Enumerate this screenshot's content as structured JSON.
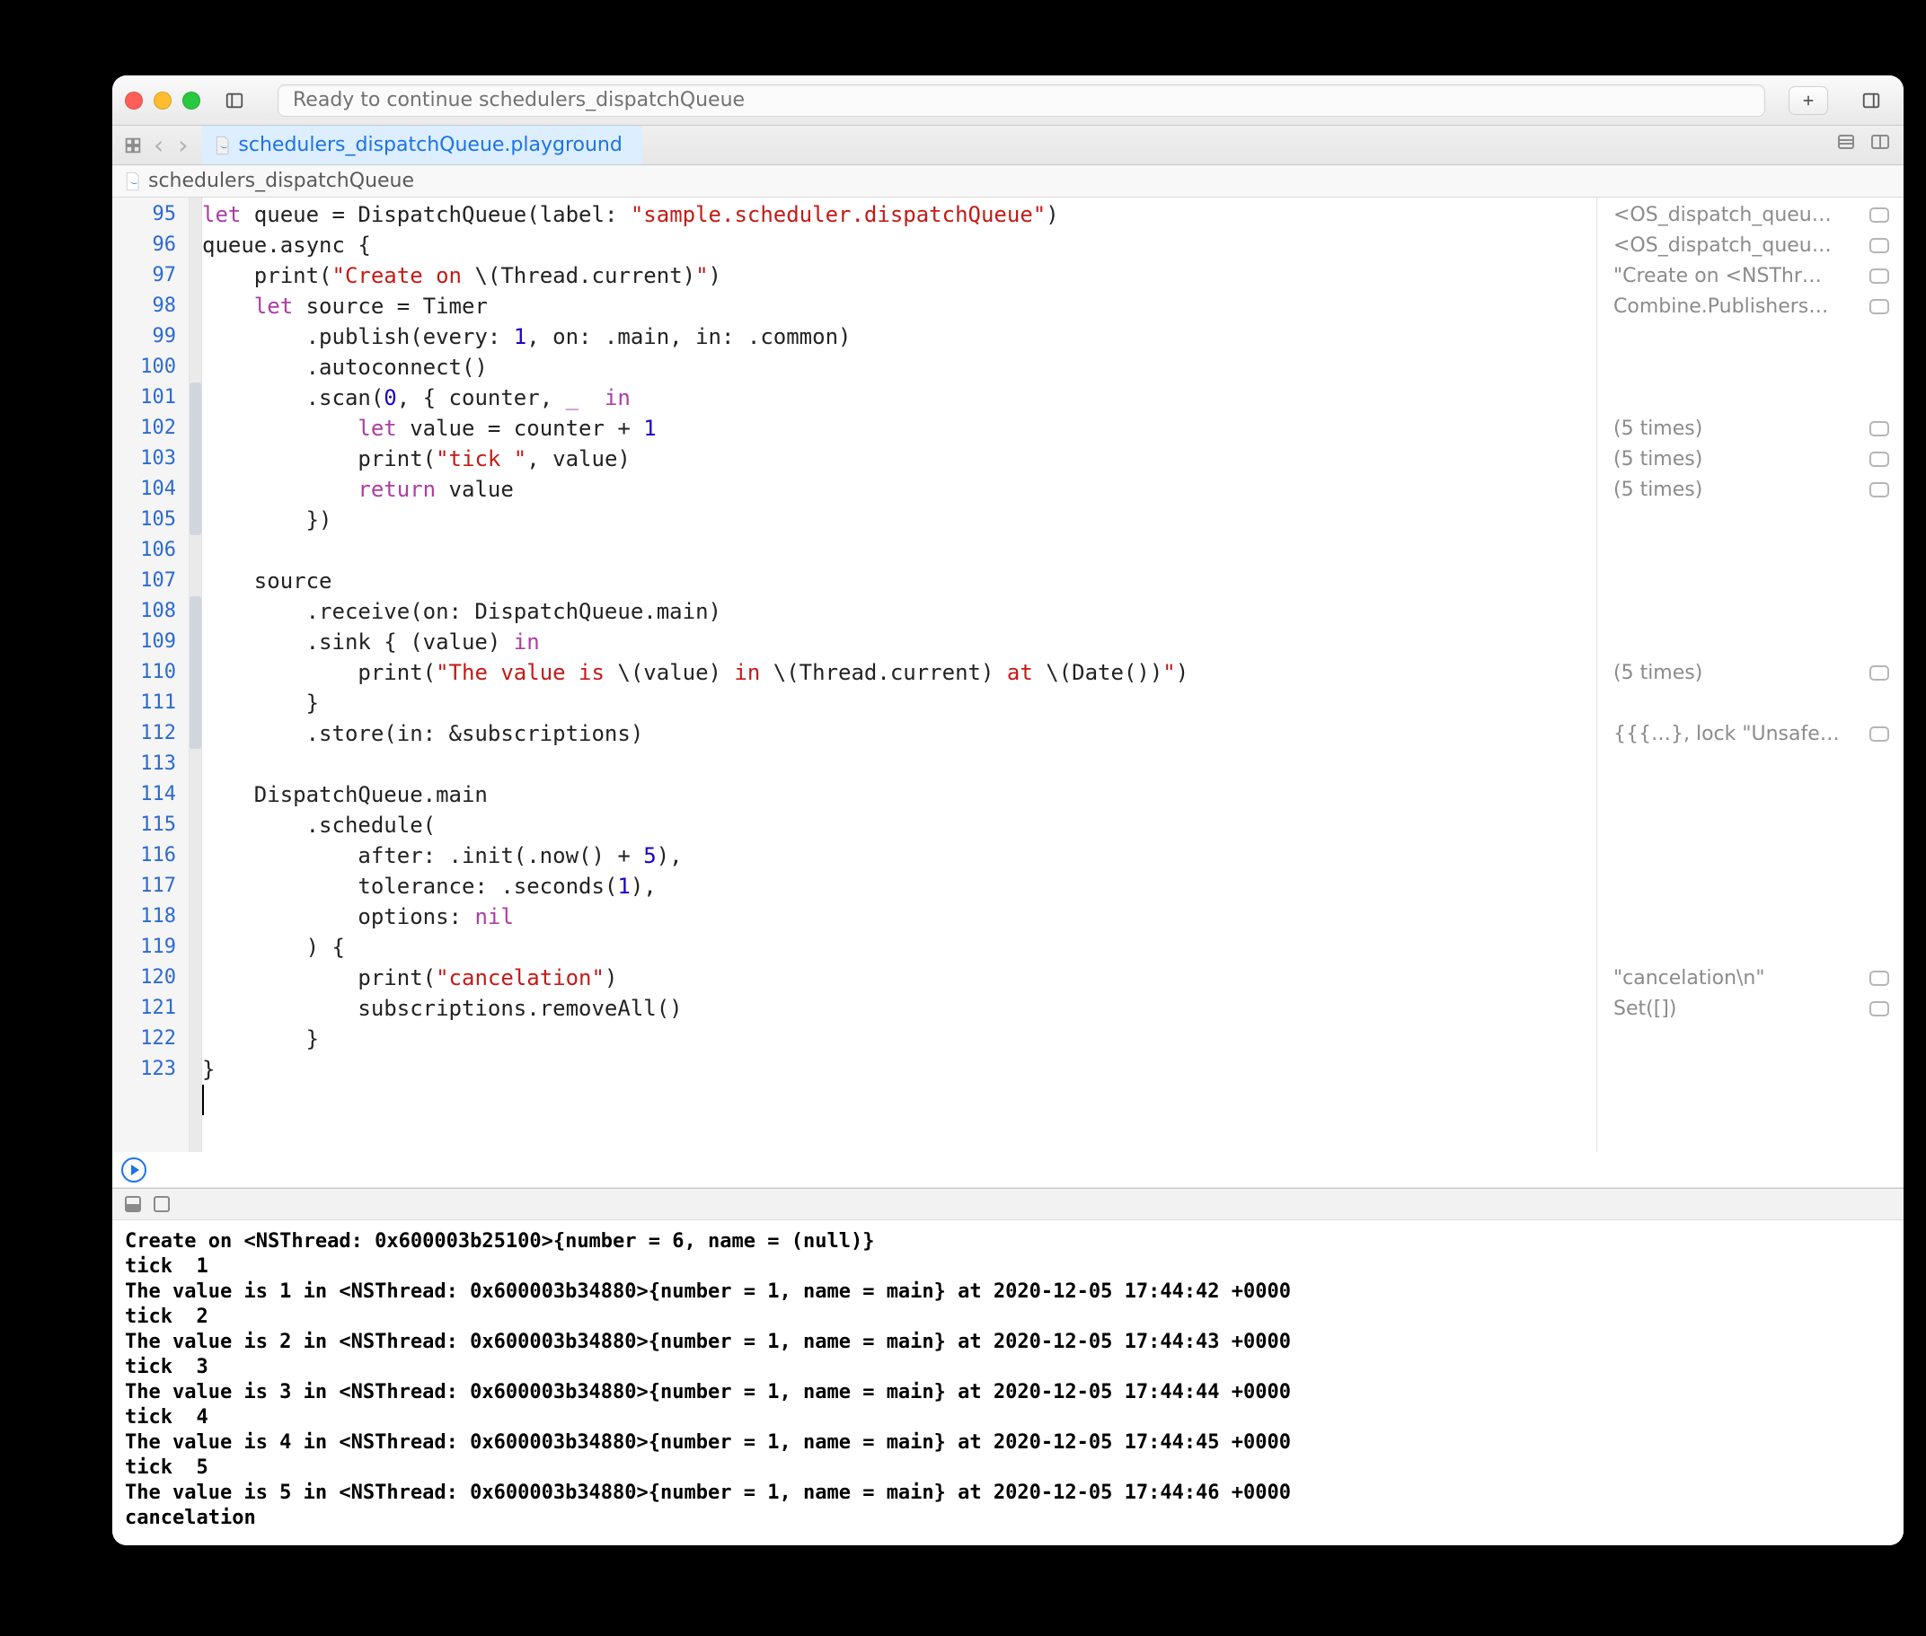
{
  "titlebar": {
    "status": "Ready to continue schedulers_dispatchQueue"
  },
  "tab": {
    "file": "schedulers_dispatchQueue.playground"
  },
  "crumb": {
    "file": "schedulers_dispatchQueue"
  },
  "gutter_start": 95,
  "code_lines": [
    {
      "i": 0,
      "segs": [
        [
          "kw",
          "let"
        ],
        [
          "",
          " queue = DispatchQueue(label: "
        ],
        [
          "str",
          "\"sample.scheduler.dispatchQueue\""
        ],
        [
          "",
          ")"
        ]
      ]
    },
    {
      "i": 0,
      "segs": [
        [
          "",
          "queue.async {"
        ]
      ]
    },
    {
      "i": 1,
      "segs": [
        [
          "",
          "print("
        ],
        [
          "str",
          "\"Create on "
        ],
        [
          "",
          "\\("
        ],
        [
          "",
          "Thread.current"
        ],
        [
          "",
          ")"
        ],
        [
          "str",
          "\""
        ],
        [
          "",
          ")"
        ]
      ]
    },
    {
      "i": 1,
      "segs": [
        [
          "kw",
          "let"
        ],
        [
          "",
          " source = Timer"
        ]
      ]
    },
    {
      "i": 2,
      "segs": [
        [
          "",
          ".publish(every: "
        ],
        [
          "num",
          "1"
        ],
        [
          "",
          ", on: .main, in: .common)"
        ]
      ]
    },
    {
      "i": 2,
      "segs": [
        [
          "",
          ".autoconnect()"
        ]
      ]
    },
    {
      "i": 2,
      "segs": [
        [
          "",
          ".scan("
        ],
        [
          "num",
          "0"
        ],
        [
          "",
          ", { counter, "
        ],
        [
          "kw",
          "_  in"
        ]
      ]
    },
    {
      "i": 3,
      "segs": [
        [
          "kw",
          "let"
        ],
        [
          "",
          " value = counter + "
        ],
        [
          "num",
          "1"
        ]
      ]
    },
    {
      "i": 3,
      "segs": [
        [
          "",
          "print("
        ],
        [
          "str",
          "\"tick \""
        ],
        [
          "",
          ", value)"
        ]
      ]
    },
    {
      "i": 3,
      "segs": [
        [
          "kw",
          "return"
        ],
        [
          "",
          " value"
        ]
      ]
    },
    {
      "i": 2,
      "segs": [
        [
          "",
          "})"
        ]
      ]
    },
    {
      "i": 0,
      "segs": [
        [
          "",
          ""
        ]
      ]
    },
    {
      "i": 1,
      "segs": [
        [
          "",
          "source"
        ]
      ]
    },
    {
      "i": 2,
      "segs": [
        [
          "",
          ".receive(on: DispatchQueue.main)"
        ]
      ]
    },
    {
      "i": 2,
      "segs": [
        [
          "",
          ".sink { (value) "
        ],
        [
          "kw",
          "in"
        ]
      ]
    },
    {
      "i": 3,
      "segs": [
        [
          "",
          "print("
        ],
        [
          "str",
          "\"The value is "
        ],
        [
          "",
          "\\("
        ],
        [
          "",
          "value"
        ],
        [
          "",
          ")"
        ],
        [
          "str",
          " in "
        ],
        [
          "",
          "\\("
        ],
        [
          "",
          "Thread.current"
        ],
        [
          "",
          ")"
        ],
        [
          "str",
          " at "
        ],
        [
          "",
          "\\("
        ],
        [
          "",
          "Date()"
        ],
        [
          "",
          ")"
        ],
        [
          "str",
          "\""
        ],
        [
          "",
          ")"
        ]
      ]
    },
    {
      "i": 2,
      "segs": [
        [
          "",
          "}"
        ]
      ]
    },
    {
      "i": 2,
      "segs": [
        [
          "",
          ".store(in: &subscriptions)"
        ]
      ]
    },
    {
      "i": 0,
      "segs": [
        [
          "",
          ""
        ]
      ]
    },
    {
      "i": 1,
      "segs": [
        [
          "",
          "DispatchQueue.main"
        ]
      ]
    },
    {
      "i": 2,
      "segs": [
        [
          "",
          ".schedule("
        ]
      ]
    },
    {
      "i": 3,
      "segs": [
        [
          "",
          "after: .init(.now() + "
        ],
        [
          "num",
          "5"
        ],
        [
          "",
          "),"
        ]
      ]
    },
    {
      "i": 3,
      "segs": [
        [
          "",
          "tolerance: .seconds("
        ],
        [
          "num",
          "1"
        ],
        [
          "",
          "),"
        ]
      ]
    },
    {
      "i": 3,
      "segs": [
        [
          "",
          "options: "
        ],
        [
          "nil",
          "nil"
        ]
      ]
    },
    {
      "i": 2,
      "segs": [
        [
          "",
          ") {"
        ]
      ]
    },
    {
      "i": 3,
      "segs": [
        [
          "",
          "print("
        ],
        [
          "str",
          "\"cancelation\""
        ],
        [
          "",
          ")"
        ]
      ]
    },
    {
      "i": 3,
      "segs": [
        [
          "",
          "subscriptions.removeAll()"
        ]
      ]
    },
    {
      "i": 2,
      "segs": [
        [
          "",
          "}"
        ]
      ]
    },
    {
      "i": 0,
      "segs": [
        [
          "",
          "}"
        ]
      ]
    }
  ],
  "sidebar": [
    {
      "line": 95,
      "text": "<OS_dispatch_queu…"
    },
    {
      "line": 96,
      "text": "<OS_dispatch_queu…"
    },
    {
      "line": 97,
      "text": "\"Create on <NSThr…"
    },
    {
      "line": 98,
      "text": "Combine.Publishers…"
    },
    {
      "line": 102,
      "text": "(5 times)"
    },
    {
      "line": 103,
      "text": "(5 times)"
    },
    {
      "line": 104,
      "text": "(5 times)"
    },
    {
      "line": 110,
      "text": "(5 times)"
    },
    {
      "line": 112,
      "text": "{{{…}, lock \"Unsafe…"
    },
    {
      "line": 120,
      "text": "\"cancelation\\n\""
    },
    {
      "line": 121,
      "text": "Set([])"
    }
  ],
  "ribbons": [
    {
      "from": 101,
      "to": 105
    },
    {
      "from": 108,
      "to": 112
    }
  ],
  "console": [
    "Create on <NSThread: 0x600003b25100>{number = 6, name = (null)}",
    "tick  1",
    "The value is 1 in <NSThread: 0x600003b34880>{number = 1, name = main} at 2020-12-05 17:44:42 +0000",
    "tick  2",
    "The value is 2 in <NSThread: 0x600003b34880>{number = 1, name = main} at 2020-12-05 17:44:43 +0000",
    "tick  3",
    "The value is 3 in <NSThread: 0x600003b34880>{number = 1, name = main} at 2020-12-05 17:44:44 +0000",
    "tick  4",
    "The value is 4 in <NSThread: 0x600003b34880>{number = 1, name = main} at 2020-12-05 17:44:45 +0000",
    "tick  5",
    "The value is 5 in <NSThread: 0x600003b34880>{number = 1, name = main} at 2020-12-05 17:44:46 +0000",
    "cancelation"
  ]
}
